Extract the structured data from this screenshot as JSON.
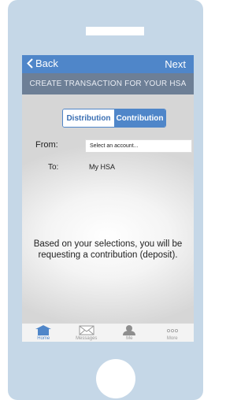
{
  "nav": {
    "back_label": "Back",
    "next_label": "Next"
  },
  "header": {
    "title": "CREATE TRANSACTION FOR YOUR HSA"
  },
  "segment": {
    "distribution_label": "Distribution",
    "contribution_label": "Contribution",
    "selected": "Contribution"
  },
  "form": {
    "from_label": "From:",
    "from_value": "Select an account...",
    "to_label": "To:",
    "to_value": "My HSA"
  },
  "message": "Based on your selections, you will be requesting a contribution (deposit).",
  "tabs": [
    {
      "label": "Home",
      "icon": "home-icon",
      "active": true
    },
    {
      "label": "Messages",
      "icon": "envelope-icon",
      "active": false
    },
    {
      "label": "Me",
      "icon": "person-icon",
      "active": false
    },
    {
      "label": "More",
      "icon": "more-dots-icon",
      "active": false
    }
  ],
  "colors": {
    "accent": "#4f86c9",
    "subheader": "#6d7f96",
    "phone_frame": "#c5d7e7"
  }
}
